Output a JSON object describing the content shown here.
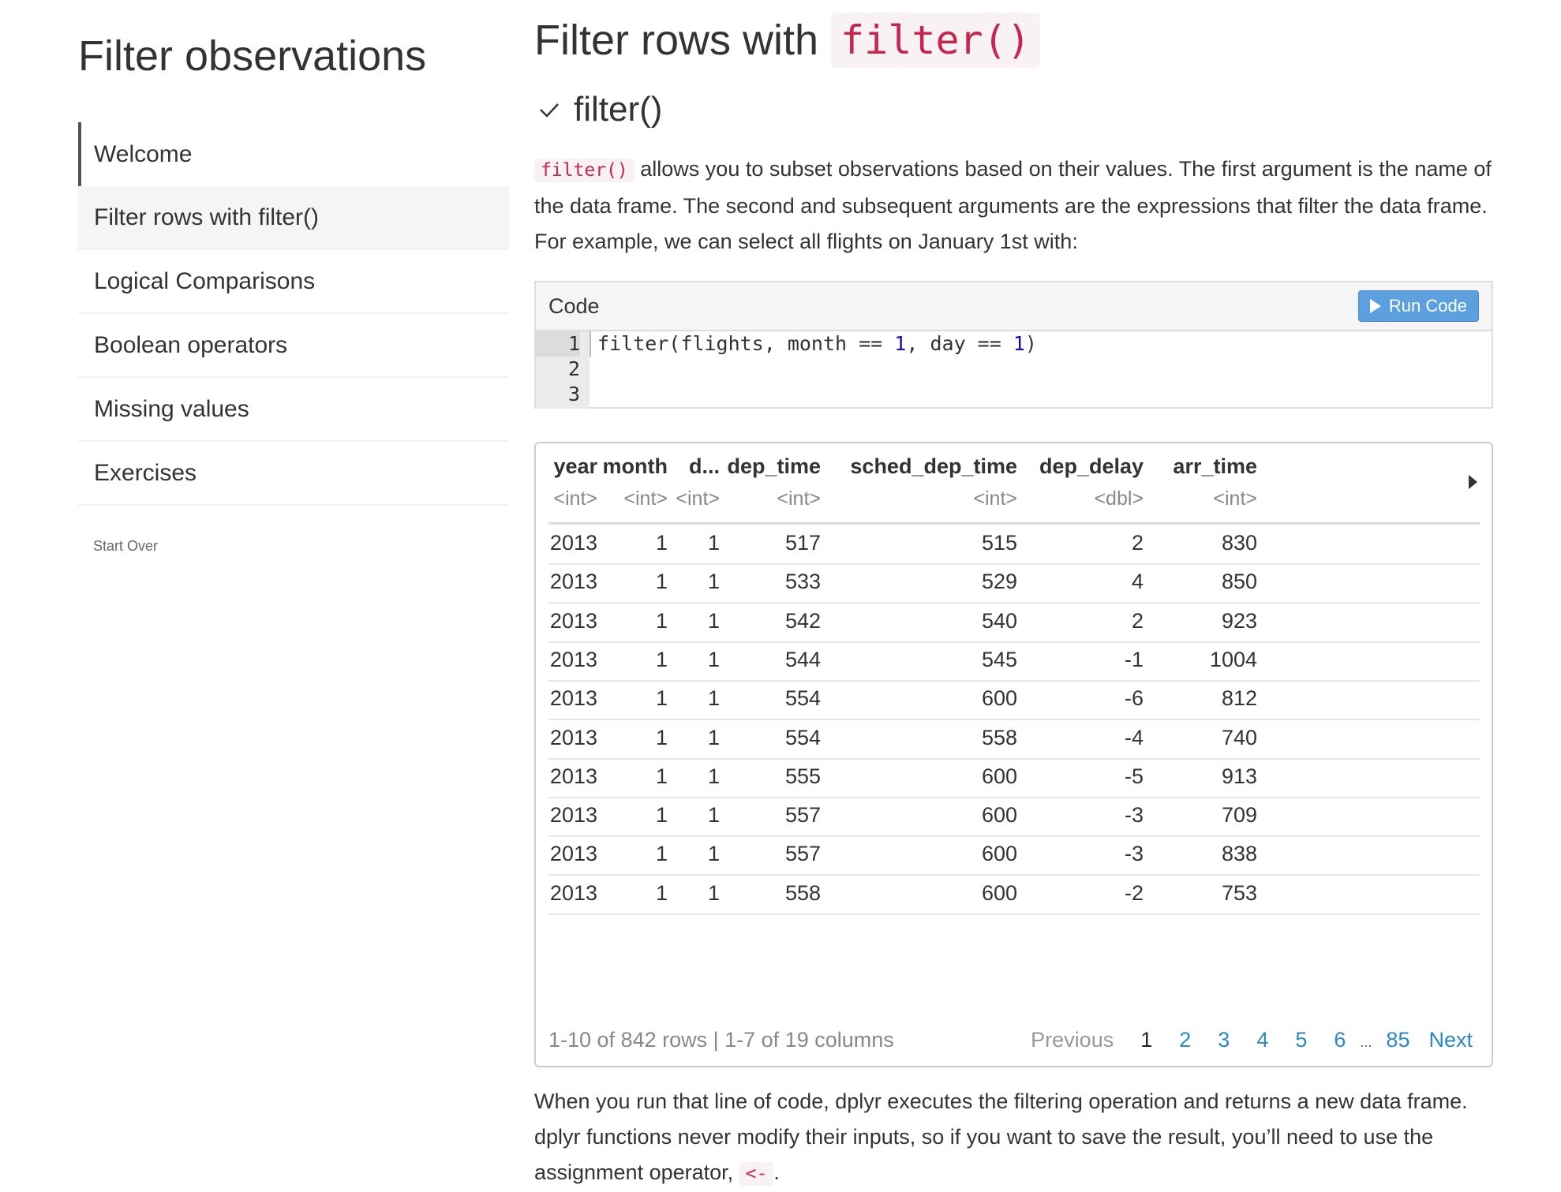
{
  "sidebar": {
    "title": "Filter observations",
    "items": [
      {
        "label": "Welcome"
      },
      {
        "label": "Filter rows with filter()"
      },
      {
        "label": "Logical Comparisons"
      },
      {
        "label": "Boolean operators"
      },
      {
        "label": "Missing values"
      },
      {
        "label": "Exercises"
      }
    ],
    "start_over": "Start Over"
  },
  "main": {
    "title_text": "Filter rows with",
    "title_code": "filter()",
    "section_title": "filter()",
    "intro_code": "filter()",
    "intro_text": " allows you to subset observations based on their values. The first argument is the name of the data frame. The second and subsequent arguments are the expressions that filter the data frame. For example, we can select all flights on January 1st with:",
    "code_box": {
      "label": "Code",
      "run_label": "Run Code",
      "line_numbers": [
        "1",
        "2",
        "3"
      ],
      "code": {
        "fn": "filter(flights, month == ",
        "n1": "1",
        "mid": ", day == ",
        "n2": "1",
        "end": ")"
      }
    },
    "table": {
      "columns": [
        {
          "name": "year",
          "type": "<int>"
        },
        {
          "name": "month",
          "type": "<int>"
        },
        {
          "name": "d...",
          "type": "<int>"
        },
        {
          "name": "dep_time",
          "type": "<int>"
        },
        {
          "name": "sched_dep_time",
          "type": "<int>"
        },
        {
          "name": "dep_delay",
          "type": "<dbl>"
        },
        {
          "name": "arr_time",
          "type": "<int>"
        }
      ],
      "rows": [
        [
          "2013",
          "1",
          "1",
          "517",
          "515",
          "2",
          "830"
        ],
        [
          "2013",
          "1",
          "1",
          "533",
          "529",
          "4",
          "850"
        ],
        [
          "2013",
          "1",
          "1",
          "542",
          "540",
          "2",
          "923"
        ],
        [
          "2013",
          "1",
          "1",
          "544",
          "545",
          "-1",
          "1004"
        ],
        [
          "2013",
          "1",
          "1",
          "554",
          "600",
          "-6",
          "812"
        ],
        [
          "2013",
          "1",
          "1",
          "554",
          "558",
          "-4",
          "740"
        ],
        [
          "2013",
          "1",
          "1",
          "555",
          "600",
          "-5",
          "913"
        ],
        [
          "2013",
          "1",
          "1",
          "557",
          "600",
          "-3",
          "709"
        ],
        [
          "2013",
          "1",
          "1",
          "557",
          "600",
          "-3",
          "838"
        ],
        [
          "2013",
          "1",
          "1",
          "558",
          "600",
          "-2",
          "753"
        ]
      ],
      "footer_info": "1-10 of 842 rows | 1-7 of 19 columns",
      "pager": {
        "previous": "Previous",
        "pages": [
          "1",
          "2",
          "3",
          "4",
          "5",
          "6"
        ],
        "ellipsis": "...",
        "last": "85",
        "next": "Next"
      }
    },
    "outro_text": "When you run that line of code, dplyr executes the filtering operation and returns a new data frame. dplyr functions never modify their inputs, so if you want to save the result, you’ll need to use the assignment operator, ",
    "outro_code": "<-",
    "outro_end": "."
  }
}
